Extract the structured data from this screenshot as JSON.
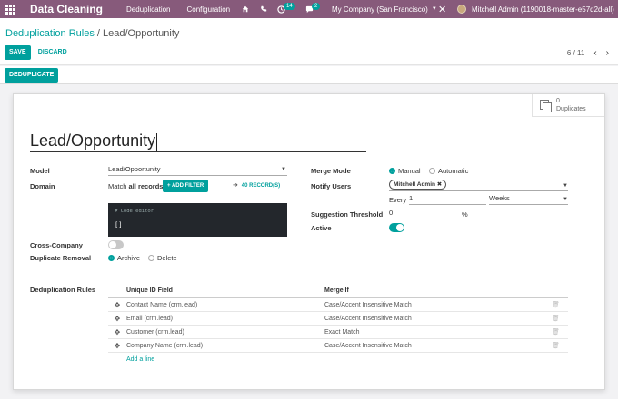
{
  "topbar": {
    "brand": "Data Cleaning",
    "menu": [
      "Deduplication",
      "Configuration"
    ],
    "activity_count": "14",
    "messages_count": "2",
    "company": "My Company (San Francisco)",
    "user": "Mitchell Admin (1190018-master-e57d2d-all)"
  },
  "breadcrumb": {
    "parent": "Deduplication Rules",
    "separator": "/",
    "current": "Lead/Opportunity"
  },
  "buttons": {
    "save": "SAVE",
    "discard": "DISCARD",
    "deduplicate": "DEDUPLICATE"
  },
  "pager": {
    "text": "6 / 11"
  },
  "smart_button": {
    "count": "0",
    "label": "Duplicates"
  },
  "record": {
    "name": "Lead/Opportunity",
    "model_label": "Model",
    "model_value": "Lead/Opportunity",
    "domain_label": "Domain",
    "domain_prefix": "Match",
    "domain_strong": "all records",
    "add_filter": "ADD FILTER",
    "records_link": "40 RECORD(S)",
    "code_hint": "# Code editor",
    "code_value": "[]",
    "cross_company_label": "Cross-Company",
    "cross_company_on": false,
    "duplicate_removal_label": "Duplicate Removal",
    "removal_options": [
      "Archive",
      "Delete"
    ],
    "removal_selected": "Archive",
    "merge_mode_label": "Merge Mode",
    "merge_options": [
      "Manual",
      "Automatic"
    ],
    "merge_selected": "Manual",
    "notify_label": "Notify Users",
    "notify_user": "Mitchell Admin",
    "every_label": "Every",
    "every_value": "1",
    "every_unit": "Weeks",
    "threshold_label": "Suggestion Threshold",
    "threshold_value": "0",
    "threshold_unit": "%",
    "active_label": "Active",
    "active_on": true,
    "rules_label": "Deduplication Rules"
  },
  "rules_table": {
    "headers": [
      "Unique ID Field",
      "Merge If"
    ],
    "rows": [
      {
        "field": "Contact Name (crm.lead)",
        "merge": "Case/Accent Insensitive Match"
      },
      {
        "field": "Email (crm.lead)",
        "merge": "Case/Accent Insensitive Match"
      },
      {
        "field": "Customer (crm.lead)",
        "merge": "Exact Match"
      },
      {
        "field": "Company Name (crm.lead)",
        "merge": "Case/Accent Insensitive Match"
      }
    ],
    "add_line": "Add a line"
  },
  "colors": {
    "topbar": "#875a7b",
    "primary": "#00a09d",
    "toggle_off": "#c8c8c8"
  },
  "icons": [
    "apps-grid-icon",
    "home-icon",
    "phone-icon",
    "clock-icon",
    "chat-icon",
    "tools-icon",
    "drag-handle-icon",
    "trash-icon",
    "arrow-right-icon",
    "duplicates-icon"
  ]
}
